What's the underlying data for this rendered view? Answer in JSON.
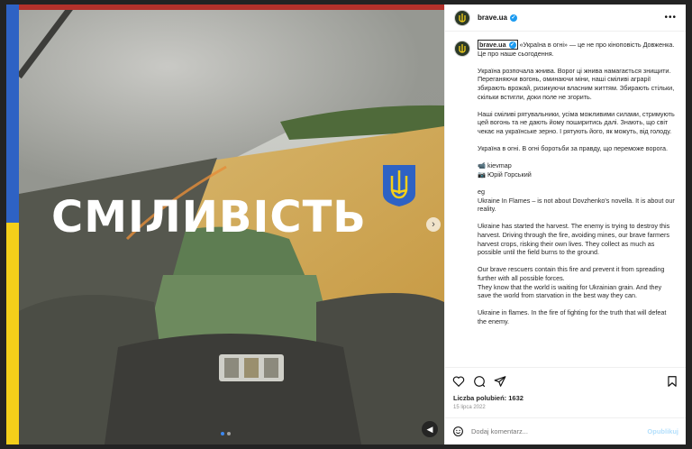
{
  "post": {
    "username": "brave.ua",
    "media": {
      "overlay_word": "СМІЛИВІСТЬ",
      "icons": [
        "trident-icon",
        "chevron-right-icon",
        "mute-icon"
      ],
      "carousel": {
        "count": 2,
        "active_index": 0
      }
    },
    "caption": {
      "username": "brave.ua",
      "first_line": "«Україна в огні» — це не про кіноповість Довженка. Це про наше сьогодення.",
      "paragraphs": [
        "Україна розпочала жнива. Ворог ці жнива намагається знищити.\nПереганяючи вогонь, оминаючи міни, наші сміливі аграрії збирають врожай, ризикуючи власним життям. Збирають стільки, скільки встигли, доки поле не згорить.",
        "Наші сміливі рятувальники, усіма можливими силами, стримують цей вогонь та не дають йому поширитись далі. Знають, що світ чекає на українське зерно. І рятують його, як можуть, від голоду.",
        "Україна в огні. В огні боротьби за правду, що переможе ворога.",
        "📹 kievmap\n📷 Юрій Горський",
        "eg\nUkraine In Flames – is not about Dovzhenko's novella. It is about our reality.",
        "Ukraine has started the harvest. The enemy is trying to destroy this harvest. Driving through the fire, avoiding mines, our brave farmers harvest crops, risking their own lives. They collect as much as possible until the field burns to the ground.",
        "Our brave rescuers contain this fire and prevent it from spreading further with all possible forces.\nThey know that the world is waiting for Ukrainian grain. And they save the world from starvation in the best way they can.",
        "Ukraine in flames. In the fire of fighting for the truth that will defeat the enemy."
      ]
    },
    "likes_text": "Liczba polubień: 1632",
    "date": "15 lipca 2022",
    "comment": {
      "placeholder": "Dodaj komentarz...",
      "post_label": "Opublikuj"
    }
  },
  "colors": {
    "flag_blue": "#2e62c4",
    "flag_yellow": "#f4cf1a",
    "verified": "#1d9bf0",
    "post_button": "#b2dffc"
  }
}
